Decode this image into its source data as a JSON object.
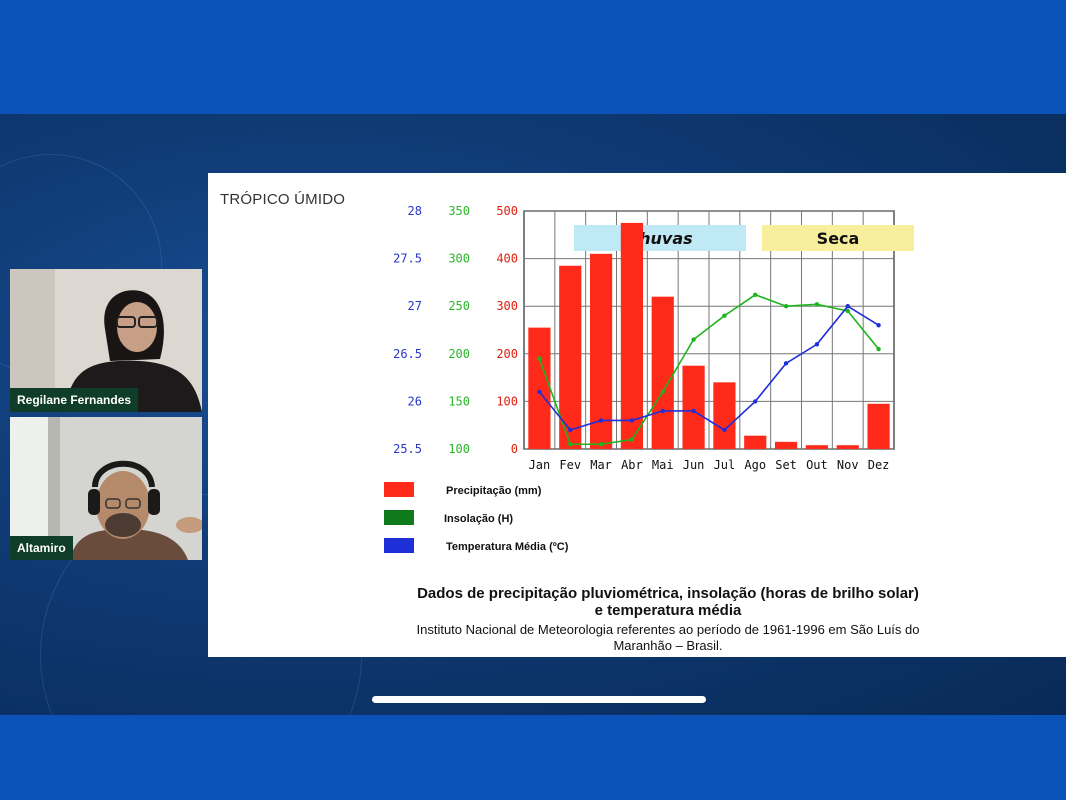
{
  "participants": [
    {
      "name": "Regilane Fernandes"
    },
    {
      "name": "Altamiro"
    }
  ],
  "slide": {
    "title": "TRÓPICO ÚMIDO",
    "caption_title_line1": "Dados de precipitação pluviométrica, insolação (horas de brilho solar)",
    "caption_title_line2": "e temperatura média",
    "caption_sub_line1": "Instituto Nacional de Meteorologia referentes ao período de 1961-1996 em São Luís do",
    "caption_sub_line2": "Maranhão – Brasil.",
    "chart_data": {
      "type": "bar",
      "categories": [
        "Jan",
        "Fev",
        "Mar",
        "Abr",
        "Mai",
        "Jun",
        "Jul",
        "Ago",
        "Set",
        "Out",
        "Nov",
        "Dez"
      ],
      "temperature_ticks": [
        "28",
        "27.5",
        "27",
        "26.5",
        "26",
        "25.5"
      ],
      "insolation_ticks": [
        "350",
        "300",
        "250",
        "200",
        "150",
        "100"
      ],
      "precipitation_ticks": [
        "500",
        "400",
        "300",
        "200",
        "100",
        "0"
      ],
      "ylim_precipitation": [
        0,
        500
      ],
      "ylim_insolation": [
        100,
        350
      ],
      "ylim_temperature": [
        25.5,
        28
      ],
      "grid": true,
      "series": [
        {
          "name": "Precipitação (mm)",
          "chart": "bar",
          "axis": "precipitation",
          "color": "#ff2a1a",
          "values": [
            255,
            385,
            410,
            475,
            320,
            175,
            140,
            28,
            15,
            8,
            8,
            95
          ]
        },
        {
          "name": "Insolação (H)",
          "chart": "line",
          "axis": "insolation",
          "color": "#1cb51c",
          "values": [
            195,
            105,
            105,
            110,
            160,
            215,
            240,
            262,
            250,
            252,
            245,
            205
          ]
        },
        {
          "name": "Temperatura Média (ºC)",
          "chart": "line",
          "axis": "temperature",
          "color": "#1f2fd8",
          "values": [
            26.1,
            25.7,
            25.8,
            25.8,
            25.9,
            25.9,
            25.7,
            26.0,
            26.4,
            26.6,
            27.0,
            26.8
          ]
        }
      ],
      "annotations": [
        {
          "text": "Chuvas",
          "color": "#bfeaf5"
        },
        {
          "text": "Seca",
          "color": "#f7ef9c"
        }
      ],
      "legend": "bottom-left"
    }
  }
}
